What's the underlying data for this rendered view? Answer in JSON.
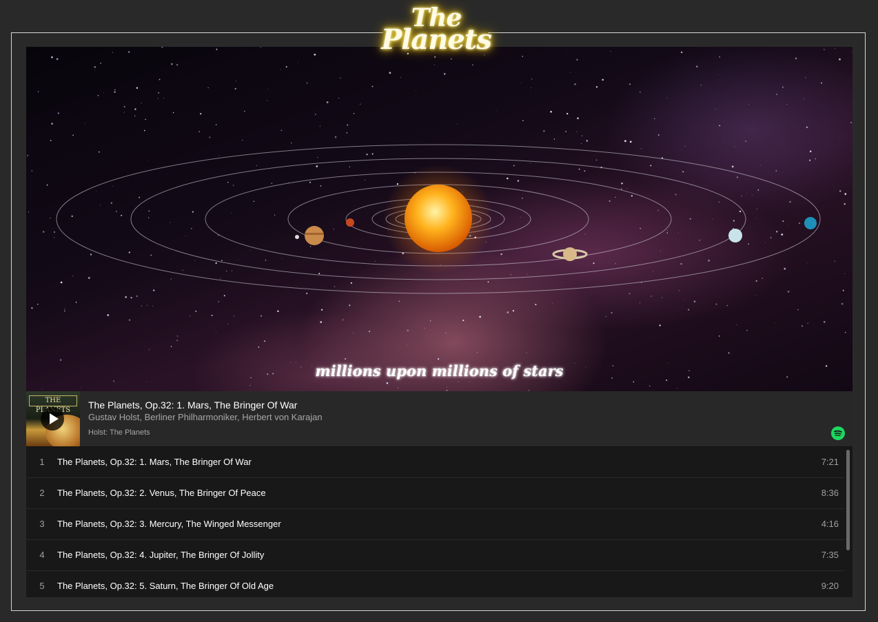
{
  "logo": {
    "line1": "The",
    "line2": "Planets"
  },
  "hero": {
    "tagline": "millions upon millions of stars"
  },
  "player": {
    "cover_title": "THE PLANETS",
    "track_title": "The Planets, Op.32: 1. Mars, The Bringer Of War",
    "artists": "Gustav Holst, Berliner Philharmoniker, Herbert von Karajan",
    "album": "Holst: The Planets"
  },
  "tracks": [
    {
      "number": "1",
      "title": "The Planets, Op.32: 1. Mars, The Bringer Of War",
      "duration": "7:21"
    },
    {
      "number": "2",
      "title": "The Planets, Op.32: 2. Venus, The Bringer Of Peace",
      "duration": "8:36"
    },
    {
      "number": "3",
      "title": "The Planets, Op.32: 3. Mercury, The Winged Messenger",
      "duration": "4:16"
    },
    {
      "number": "4",
      "title": "The Planets, Op.32: 4. Jupiter, The Bringer Of Jollity",
      "duration": "7:35"
    },
    {
      "number": "5",
      "title": "The Planets, Op.32: 5. Saturn, The Bringer Of Old Age",
      "duration": "9:20"
    }
  ],
  "colors": {
    "background": "#292929",
    "frame_border": "#d8d8d8",
    "logo_glow": "#f7d21c",
    "spotify_green": "#1ed760",
    "tracklist_bg": "#181818"
  },
  "icons": {
    "play": "play-icon",
    "spotify": "spotify-logo-icon"
  }
}
